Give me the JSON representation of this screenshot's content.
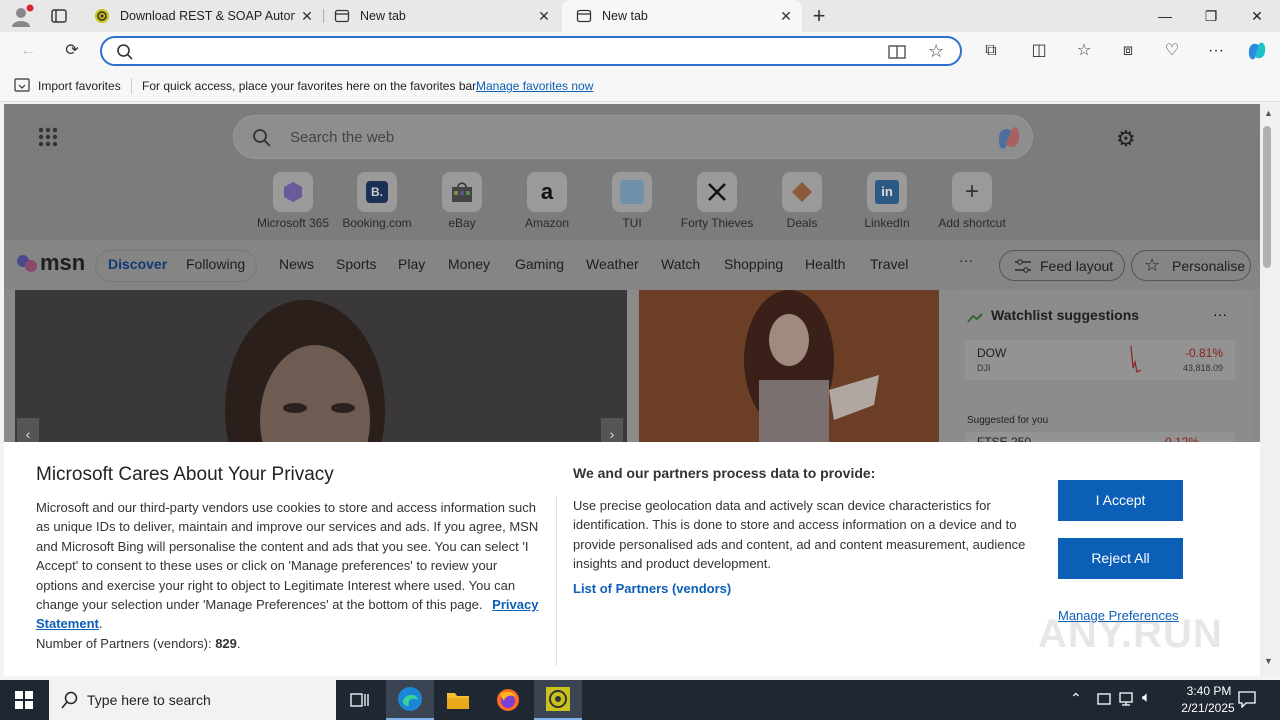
{
  "browser": {
    "tabs": [
      {
        "label": "Download REST & SOAP Automa",
        "icon": "soapui-icon"
      },
      {
        "label": "New tab",
        "icon": "newtab-icon"
      },
      {
        "label": "New tab",
        "icon": "newtab-icon"
      }
    ],
    "address_value": "",
    "favorites_bar": {
      "import_label": "Import favorites",
      "hint_text": "For quick access, place your favorites here on the favorites bar.",
      "manage_link": "Manage favorites now"
    }
  },
  "newtab": {
    "search_placeholder": "Search the web",
    "shortcuts": [
      {
        "label": "Microsoft 365"
      },
      {
        "label": "Booking.com"
      },
      {
        "label": "eBay"
      },
      {
        "label": "Amazon"
      },
      {
        "label": "TUI"
      },
      {
        "label": "Forty Thieves"
      },
      {
        "label": "Deals"
      },
      {
        "label": "LinkedIn"
      },
      {
        "label": "Add shortcut"
      }
    ],
    "msn": {
      "logo": "msn",
      "tabs": [
        "Discover",
        "Following"
      ],
      "nav": [
        "News",
        "Sports",
        "Play",
        "Money",
        "Gaming",
        "Weather",
        "Watch",
        "Shopping",
        "Health",
        "Travel"
      ],
      "more": "···",
      "feed_layout": "Feed layout",
      "personalise": "Personalise"
    },
    "watchlist": {
      "title": "Watchlist suggestions",
      "more": "···",
      "items": [
        {
          "name": "DOW",
          "sub": "DJI",
          "change": "-0.81%",
          "value": "43,818.09"
        },
        {
          "name": "FTSE 250",
          "change": "-0.12%"
        }
      ],
      "suggested_label": "Suggested for you"
    }
  },
  "consent": {
    "title": "Microsoft Cares About Your Privacy",
    "body": "Microsoft and our third-party vendors use cookies to store and access information such as unique IDs to deliver, maintain and improve our services and ads. If you agree, MSN and Microsoft Bing will personalise the content and ads that you see. You can select 'I Accept' to consent to these uses or click on 'Manage preferences' to review your options and exercise your right to object to Legitimate Interest where used.  You can change your selection under 'Manage Preferences' at the bottom of this page.",
    "privacy_link": "Privacy Statement",
    "partners_label": "Number of Partners (vendors):",
    "partners_count": "829",
    "right_title": "We and our partners process data to provide:",
    "right_body": "Use precise geolocation data and actively scan device characteristics for identification. This is done to store and access information on a device and to provide personalised ads and content, ad and content measurement, audience insights and product development.",
    "partners_link": "List of Partners (vendors)",
    "accept": "I Accept",
    "reject": "Reject All",
    "manage": "Manage Preferences"
  },
  "taskbar": {
    "search_placeholder": "Type here to search",
    "time": "3:40 PM",
    "date": "2/21/2025"
  },
  "watermark": "ANY.RUN",
  "colors": {
    "accent": "#0c5fb7",
    "address_border": "#2f6fd0",
    "taskbar": "#1f2733"
  }
}
